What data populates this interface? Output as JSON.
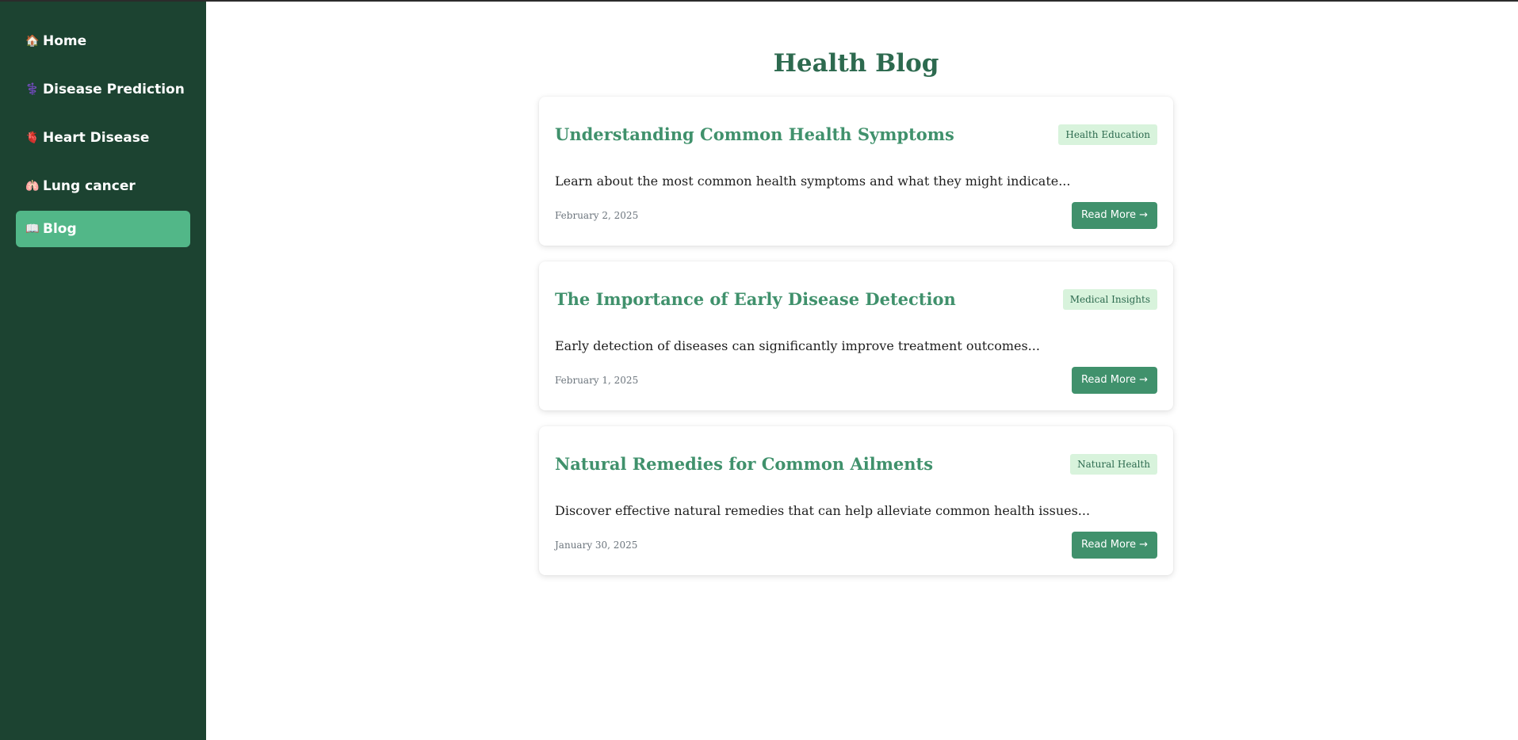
{
  "sidebar": {
    "items": [
      {
        "label": "Home",
        "icon": "🏠"
      },
      {
        "label": "Disease Prediction",
        "icon": "⚕️"
      },
      {
        "label": "Heart Disease",
        "icon": "🫀"
      },
      {
        "label": "Lung cancer",
        "icon": "🫁"
      },
      {
        "label": "Blog",
        "icon": "📖"
      }
    ],
    "active_index": 4
  },
  "main": {
    "title": "Health Blog",
    "posts": [
      {
        "title": "Understanding Common Health Symptoms",
        "tag": "Health Education",
        "excerpt": "Learn about the most common health symptoms and what they might indicate...",
        "date": "February 2, 2025",
        "read_more": "Read More →"
      },
      {
        "title": "The Importance of Early Disease Detection",
        "tag": "Medical Insights",
        "excerpt": "Early detection of diseases can significantly improve treatment outcomes...",
        "date": "February 1, 2025",
        "read_more": "Read More →"
      },
      {
        "title": "Natural Remedies for Common Ailments",
        "tag": "Natural Health",
        "excerpt": "Discover effective natural remedies that can help alleviate common health issues...",
        "date": "January 30, 2025",
        "read_more": "Read More →"
      }
    ]
  },
  "colors": {
    "sidebar_bg": "#1c4331",
    "active_item_bg": "#52b788",
    "title_green": "#2d6a4f",
    "accent_green": "#40916c",
    "tag_bg": "#d8f3dc"
  }
}
